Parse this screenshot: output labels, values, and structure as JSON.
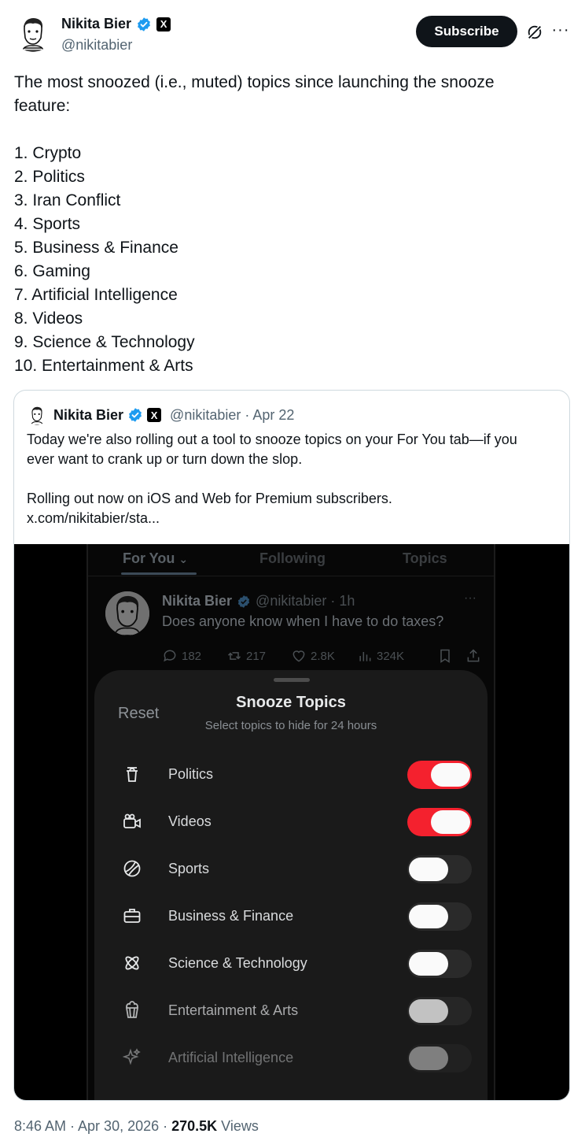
{
  "author": {
    "name": "Nikita Bier",
    "handle": "@nikitabier",
    "verified_color": "#1d9bf0",
    "affiliation_badge": "X"
  },
  "header": {
    "subscribe_label": "Subscribe",
    "grok_icon": "grok-icon",
    "more_icon": "more-icon"
  },
  "tweet": {
    "intro_line1": "The most snoozed (i.e., muted) topics since launching the snooze",
    "intro_line2": "feature:",
    "list": [
      "1. Crypto",
      "2. Politics",
      "3. Iran Conflict",
      "4. Sports",
      "5. Business & Finance",
      "6. Gaming",
      "7. Artificial Intelligence",
      "8. Videos",
      "9. Science & Technology",
      "10. Entertainment & Arts"
    ]
  },
  "quote": {
    "name": "Nikita Bier",
    "handle": "@nikitabier",
    "date": "· Apr 22",
    "badge": "X",
    "line1": "Today we're also rolling out a tool to snooze topics on your For You tab—if you",
    "line2": "ever want to crank up or turn down the slop.",
    "line3": "Rolling out now on iOS and Web for Premium subscribers.",
    "line4": "x.com/nikitabier/sta..."
  },
  "screenshot": {
    "tabs": [
      "For You",
      "Following",
      "Topics"
    ],
    "tab_chevron": "⌄",
    "inner_post": {
      "name": "Nikita Bier",
      "handle": "@nikitabier · 1h",
      "text": "Does anyone know when I have to do taxes?",
      "dots": "···",
      "replies": "182",
      "reposts": "217",
      "likes": "2.8K",
      "views": "324K"
    },
    "sheet": {
      "reset_label": "Reset",
      "title": "Snooze Topics",
      "subtitle": "Select topics to hide for 24 hours",
      "topics": [
        {
          "label": "Politics",
          "icon": "podium-icon",
          "on": true
        },
        {
          "label": "Videos",
          "icon": "video-camera-icon",
          "on": true
        },
        {
          "label": "Sports",
          "icon": "ball-icon",
          "on": false
        },
        {
          "label": "Business & Finance",
          "icon": "briefcase-icon",
          "on": false
        },
        {
          "label": "Science & Technology",
          "icon": "atom-icon",
          "on": false
        },
        {
          "label": "Entertainment & Arts",
          "icon": "popcorn-icon",
          "on": false
        },
        {
          "label": "Artificial Intelligence",
          "icon": "sparkle-icon",
          "on": false
        }
      ],
      "toggle_on_color": "#f4212e"
    }
  },
  "footer": {
    "time": "8:46 AM · Apr 30, 2026 · ",
    "views_count": "270.5K",
    "views_label": " Views"
  }
}
